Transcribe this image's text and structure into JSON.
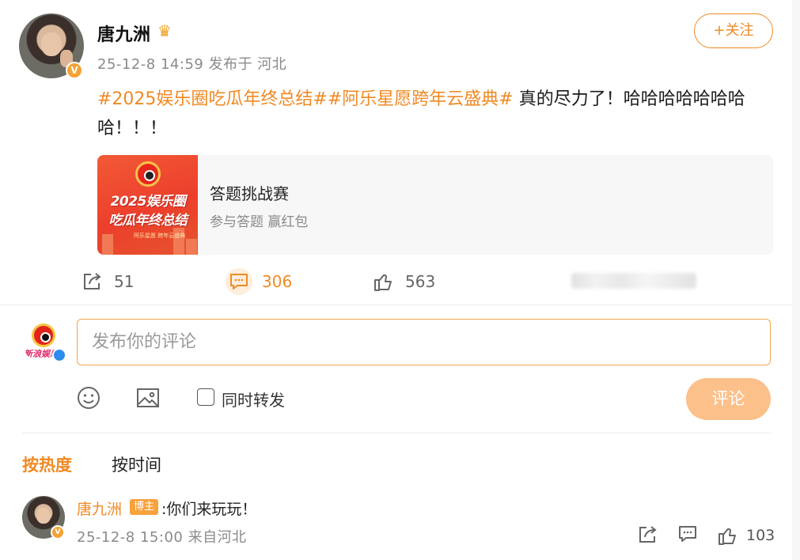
{
  "post": {
    "author": "唐九洲",
    "crown_icon": "crown-icon",
    "meta": "25-12-8 14:59 发布于 河北",
    "follow_label": "+关注",
    "topics": [
      "#2025娱乐圈吃瓜年终总结#",
      "#阿乐星愿跨年云盛典#"
    ],
    "text": " 真的尽力了！哈哈哈哈哈哈哈哈！！！",
    "card": {
      "thumb_line1": "2025娱乐圈",
      "thumb_line2": "吃瓜年终总结",
      "thumb_small": "阿乐星愿 跨年云盛典",
      "title": "答题挑战赛",
      "subtitle": "参与答题 赢红包"
    },
    "actions": {
      "forward_count": "51",
      "comment_count": "306",
      "like_count": "563"
    }
  },
  "composer": {
    "placeholder": "发布你的评论",
    "repost_label": "同时转发",
    "submit_label": "评论",
    "avatar_text": "新浪娱乐"
  },
  "sort": {
    "hot_label": "按热度",
    "time_label": "按时间"
  },
  "comments": [
    {
      "name": "唐九洲",
      "badge": "博主",
      "text": ":你们来玩玩！",
      "time": "25-12-8 15:00 来自河北",
      "like_count": "103"
    }
  ],
  "colors": {
    "accent": "#f08a24",
    "submit_disabled": "#fcc08a",
    "badge_gold": "#f4a233"
  }
}
